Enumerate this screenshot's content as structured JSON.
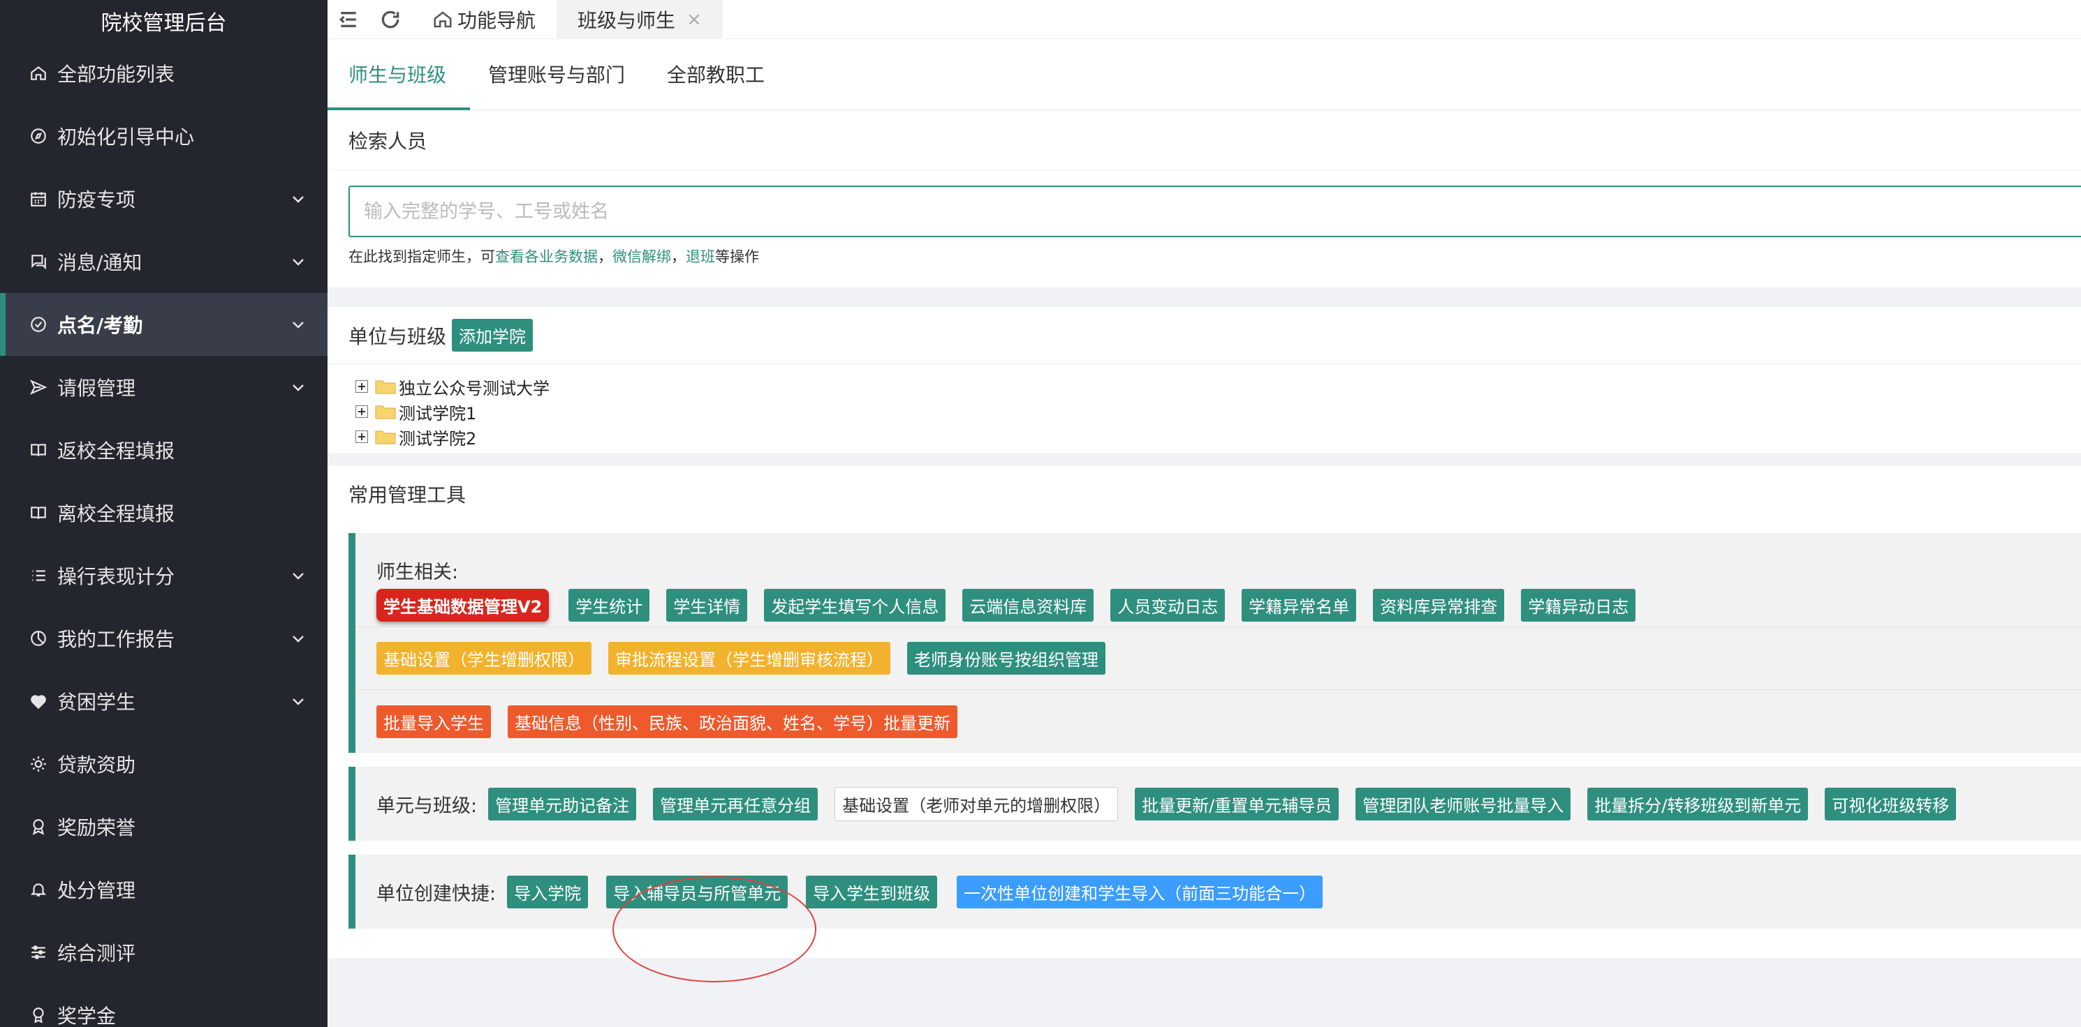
{
  "sidebar": {
    "title": "院校管理后台",
    "items": [
      {
        "label": "全部功能列表",
        "icon": "home-icon",
        "arrow": false,
        "active": false
      },
      {
        "label": "初始化引导中心",
        "icon": "compass-icon",
        "arrow": false,
        "active": false
      },
      {
        "label": "防疫专项",
        "icon": "calendar-icon",
        "arrow": true,
        "active": false
      },
      {
        "label": "消息/通知",
        "icon": "chat-icon",
        "arrow": true,
        "active": false
      },
      {
        "label": "点名/考勤",
        "icon": "check-circle-icon",
        "arrow": true,
        "active": true
      },
      {
        "label": "请假管理",
        "icon": "send-icon",
        "arrow": true,
        "active": false
      },
      {
        "label": "返校全程填报",
        "icon": "book-icon",
        "arrow": false,
        "active": false
      },
      {
        "label": "离校全程填报",
        "icon": "book-icon",
        "arrow": false,
        "active": false
      },
      {
        "label": "操行表现计分",
        "icon": "list-icon",
        "arrow": true,
        "active": false
      },
      {
        "label": "我的工作报告",
        "icon": "pie-icon",
        "arrow": true,
        "active": false
      },
      {
        "label": "贫困学生",
        "icon": "heart-icon",
        "arrow": true,
        "active": false
      },
      {
        "label": "贷款资助",
        "icon": "sun-icon",
        "arrow": false,
        "active": false
      },
      {
        "label": "奖励荣誉",
        "icon": "medal-icon",
        "arrow": false,
        "active": false
      },
      {
        "label": "处分管理",
        "icon": "bell-icon",
        "arrow": false,
        "active": false
      },
      {
        "label": "综合测评",
        "icon": "sliders-icon",
        "arrow": false,
        "active": false
      },
      {
        "label": "奖学金",
        "icon": "award-icon",
        "arrow": false,
        "active": false
      }
    ]
  },
  "topbar": {
    "tabs": [
      {
        "label": "功能导航",
        "active": false
      },
      {
        "label": "班级与师生",
        "active": true,
        "close": "×"
      }
    ]
  },
  "subtabs": [
    "师生与班级",
    "管理账号与部门",
    "全部教职工"
  ],
  "search": {
    "title": "检索人员",
    "placeholder": "输入完整的学号、工号或姓名",
    "hint_prefix": "在此找到指定师生，可",
    "hint_link1": "查看各业务数据",
    "hint_sep1": "，",
    "hint_link2": "微信解绑",
    "hint_sep2": "，",
    "hint_link3": "退班",
    "hint_suffix": "等操作"
  },
  "units": {
    "title": "单位与班级",
    "add_button": "添加学院",
    "tree": [
      "独立公众号测试大学",
      "测试学院1",
      "测试学院2"
    ]
  },
  "tools": {
    "title": "常用管理工具",
    "teacher_student": {
      "title": "师生相关:",
      "row1": [
        "学生基础数据管理V2",
        "学生统计",
        "学生详情",
        "发起学生填写个人信息",
        "云端信息资料库",
        "人员变动日志",
        "学籍异常名单",
        "资料库异常排查",
        "学籍异动日志"
      ],
      "row2": [
        "基础设置（学生增删权限）",
        "审批流程设置（学生增删审核流程）",
        "老师身份账号按组织管理"
      ],
      "row3": [
        "批量导入学生",
        "基础信息（性别、民族、政治面貌、姓名、学号）批量更新"
      ]
    },
    "unit_class": {
      "title": "单元与班级:",
      "buttons": [
        "管理单元助记备注",
        "管理单元再任意分组",
        "基础设置（老师对单元的增删权限）",
        "批量更新/重置单元辅导员",
        "管理团队老师账号批量导入",
        "批量拆分/转移班级到新单元",
        "可视化班级转移"
      ]
    },
    "quick_create": {
      "title": "单位创建快捷:",
      "buttons": [
        "导入学院",
        "导入辅导员与所管单元",
        "导入学生到班级",
        "一次性单位创建和学生导入（前面三功能合一）"
      ]
    }
  },
  "colors": {
    "accent": "#2f8f7f",
    "sidebar_bg": "#23262e",
    "active_item_bg": "#393d49",
    "btn_red": "#d8251e",
    "btn_yellow": "#f3b22d",
    "btn_orange": "#ee5a2c",
    "btn_blue": "#3b9dff",
    "annotation_ring": "#e04040"
  }
}
